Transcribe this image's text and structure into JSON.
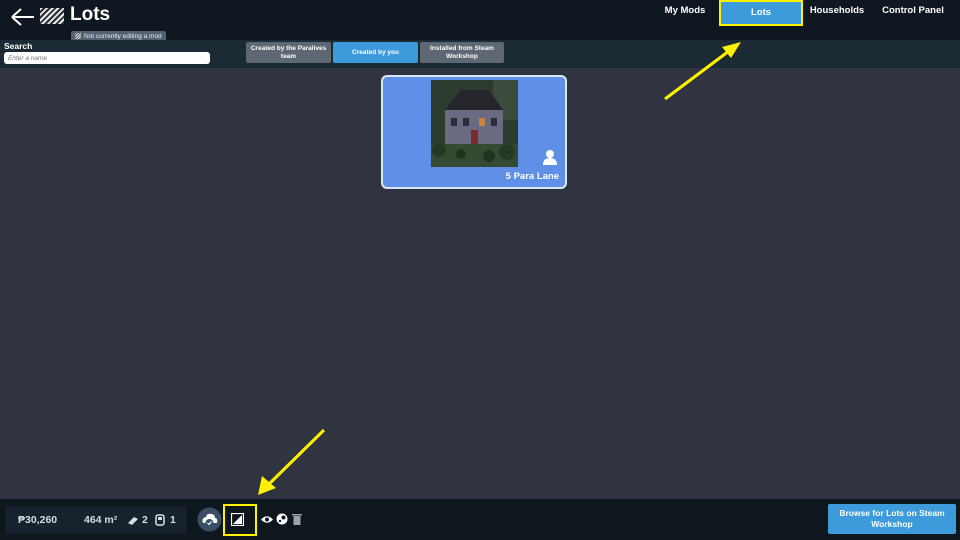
{
  "header": {
    "title": "Lots",
    "mod_status": "Not currently editing a mod",
    "back_icon": "back-arrow-icon",
    "lot_icon": "lot-pattern-icon"
  },
  "nav": {
    "tabs": [
      {
        "label": "My Mods",
        "active": false
      },
      {
        "label": "Lots",
        "active": true
      },
      {
        "label": "Households",
        "active": false
      },
      {
        "label": "Control Panel",
        "active": false
      }
    ]
  },
  "search": {
    "label": "Search",
    "placeholder": "Enter a name"
  },
  "filters": [
    {
      "label": "Created by the Paralives team",
      "active": false
    },
    {
      "label": "Created by you",
      "active": true
    },
    {
      "label": "Installed from Steam Workshop",
      "active": false
    }
  ],
  "lots": [
    {
      "name": "5 Para Lane",
      "owner_icon": "person-icon"
    }
  ],
  "footer": {
    "price": "₱30,260",
    "area": "464 m²",
    "bathrooms": "2",
    "bedrooms": "1",
    "icons": [
      "upload-cloud-icon",
      "thumbnail-icon",
      "eye-icon",
      "steam-icon",
      "trash-icon"
    ],
    "browse_label": "Browse for Lots on Steam Workshop"
  },
  "colors": {
    "accent": "#3d9bdc",
    "highlight": "#fff100",
    "card": "#5f8fe6",
    "background": "#2f3440"
  }
}
